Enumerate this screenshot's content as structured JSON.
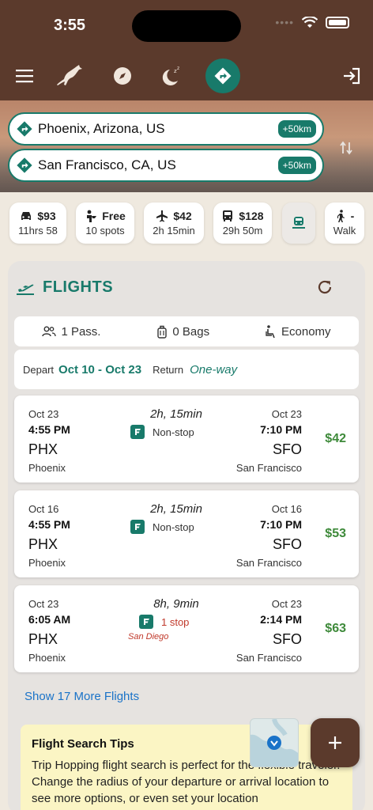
{
  "status": {
    "time": "3:55"
  },
  "origin": {
    "text": "Phoenix, Arizona, US",
    "radius": "+50km"
  },
  "destination": {
    "text": "San Francisco, CA, US",
    "radius": "+50km"
  },
  "modes": [
    {
      "icon": "car-icon",
      "value": "$93",
      "sub": "11hrs 58"
    },
    {
      "icon": "rideshare-icon",
      "value": "Free",
      "sub": "10 spots"
    },
    {
      "icon": "plane-icon",
      "value": "$42",
      "sub": "2h 15min"
    },
    {
      "icon": "bus-icon",
      "value": "$128",
      "sub": "29h 50m"
    },
    {
      "icon": "train-icon",
      "value": "",
      "sub": ""
    },
    {
      "icon": "walk-icon",
      "value": "-",
      "sub": "Walk"
    }
  ],
  "flights": {
    "title": "FLIGHTS",
    "passengers": "1 Pass.",
    "bags": "0 Bags",
    "cabin": "Economy",
    "depart_label": "Depart",
    "depart_value": "Oct 10 - Oct 23",
    "return_label": "Return",
    "return_value": "One-way",
    "results": [
      {
        "dep_date": "Oct 23",
        "dep_time": "4:55 PM",
        "dep_code": "PHX",
        "dep_city": "Phoenix",
        "duration": "2h, 15min",
        "stops": "Non-stop",
        "via": "",
        "arr_date": "Oct 23",
        "arr_time": "7:10 PM",
        "arr_code": "SFO",
        "arr_city": "San Francisco",
        "price": "$42"
      },
      {
        "dep_date": "Oct 16",
        "dep_time": "4:55 PM",
        "dep_code": "PHX",
        "dep_city": "Phoenix",
        "duration": "2h, 15min",
        "stops": "Non-stop",
        "via": "",
        "arr_date": "Oct 16",
        "arr_time": "7:10 PM",
        "arr_code": "SFO",
        "arr_city": "San Francisco",
        "price": "$53"
      },
      {
        "dep_date": "Oct 23",
        "dep_time": "6:05 AM",
        "dep_code": "PHX",
        "dep_city": "Phoenix",
        "duration": "8h, 9min",
        "stops": "1 stop",
        "via": "San Diego",
        "arr_date": "Oct 23",
        "arr_time": "2:14 PM",
        "arr_code": "SFO",
        "arr_city": "San Francisco",
        "price": "$63"
      }
    ],
    "more_link": "Show 17 More Flights"
  },
  "tips": {
    "title": "Flight Search Tips",
    "body": "Trip Hopping flight search is perfect for the flexible traveler. Change the radius of your departure or arrival location to see more options, or even set your location"
  },
  "colors": {
    "brown": "#5b3a2c",
    "teal": "#187a6a",
    "price": "#3e8a3a",
    "link": "#1a73c8",
    "stop": "#c0392b"
  }
}
